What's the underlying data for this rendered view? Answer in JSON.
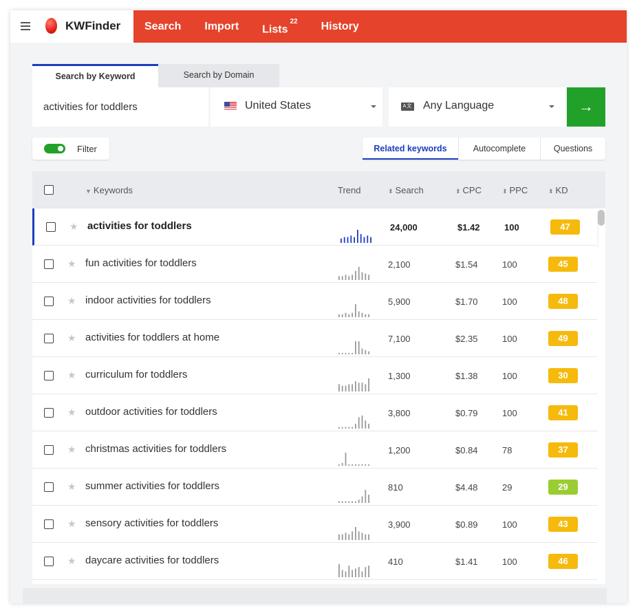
{
  "app": {
    "name": "KWFinder",
    "nav": [
      {
        "label": "Search",
        "badge": ""
      },
      {
        "label": "Import",
        "badge": ""
      },
      {
        "label": "Lists",
        "badge": "22"
      },
      {
        "label": "History",
        "badge": ""
      }
    ]
  },
  "search": {
    "tabs": [
      "Search by Keyword",
      "Search by Domain"
    ],
    "active_tab": "Search by Keyword",
    "keyword_value": "activities for toddlers",
    "location": "United States",
    "language": "Any Language",
    "lang_icon": "translate-icon",
    "go_icon": "→"
  },
  "filter": {
    "label": "Filter",
    "enabled": true
  },
  "keyword_tabs": [
    "Related keywords",
    "Autocomplete",
    "Questions"
  ],
  "active_keyword_tab": "Related keywords",
  "table": {
    "headers": {
      "keywords": "Keywords",
      "trend": "Trend",
      "search": "Search",
      "cpc": "CPC",
      "ppc": "PPC",
      "kd": "KD"
    },
    "rows": [
      {
        "keyword": "activities for toddlers",
        "search": "24,000",
        "cpc": "$1.42",
        "ppc": "100",
        "kd": "47",
        "kd_color": "#f6ba0d",
        "trend": [
          3,
          4,
          4,
          5,
          4,
          9,
          6,
          4,
          5,
          4
        ],
        "trend_color": "#1b3dbd"
      },
      {
        "keyword": "fun activities for toddlers",
        "search": "2,100",
        "cpc": "$1.54",
        "ppc": "100",
        "kd": "45",
        "kd_color": "#f6ba0d",
        "trend": [
          3,
          3,
          4,
          3,
          4,
          7,
          10,
          6,
          5,
          4
        ],
        "trend_color": "#999999"
      },
      {
        "keyword": "indoor activities for toddlers",
        "search": "5,900",
        "cpc": "$1.70",
        "ppc": "100",
        "kd": "48",
        "kd_color": "#f6ba0d",
        "trend": [
          2,
          2,
          3,
          2,
          3,
          9,
          4,
          3,
          2,
          2
        ],
        "trend_color": "#999999"
      },
      {
        "keyword": "activities for toddlers at home",
        "search": "7,100",
        "cpc": "$2.35",
        "ppc": "100",
        "kd": "49",
        "kd_color": "#f6ba0d",
        "trend": [
          1,
          1,
          1,
          1,
          1,
          9,
          9,
          4,
          3,
          2
        ],
        "trend_color": "#999999"
      },
      {
        "keyword": "curriculum for toddlers",
        "search": "1,300",
        "cpc": "$1.38",
        "ppc": "100",
        "kd": "30",
        "kd_color": "#f6ba0d",
        "trend": [
          5,
          4,
          4,
          5,
          5,
          7,
          6,
          6,
          5,
          9
        ],
        "trend_color": "#999999"
      },
      {
        "keyword": "outdoor activities for toddlers",
        "search": "3,800",
        "cpc": "$0.79",
        "ppc": "100",
        "kd": "41",
        "kd_color": "#f6ba0d",
        "trend": [
          1,
          1,
          1,
          1,
          1,
          3,
          7,
          8,
          5,
          3
        ],
        "trend_color": "#999999"
      },
      {
        "keyword": "christmas activities for toddlers",
        "search": "1,200",
        "cpc": "$0.84",
        "ppc": "78",
        "kd": "37",
        "kd_color": "#f6ba0d",
        "trend": [
          1,
          2,
          9,
          1,
          1,
          1,
          1,
          1,
          1,
          1
        ],
        "trend_color": "#999999"
      },
      {
        "keyword": "summer activities for toddlers",
        "search": "810",
        "cpc": "$4.48",
        "ppc": "29",
        "kd": "29",
        "kd_color": "#9acd32",
        "trend": [
          1,
          1,
          1,
          1,
          1,
          1,
          2,
          4,
          8,
          5
        ],
        "trend_color": "#999999"
      },
      {
        "keyword": "sensory activities for toddlers",
        "search": "3,900",
        "cpc": "$0.89",
        "ppc": "100",
        "kd": "43",
        "kd_color": "#f6ba0d",
        "trend": [
          4,
          4,
          5,
          4,
          6,
          9,
          6,
          5,
          4,
          4
        ],
        "trend_color": "#999999"
      },
      {
        "keyword": "daycare activities for toddlers",
        "search": "410",
        "cpc": "$1.41",
        "ppc": "100",
        "kd": "46",
        "kd_color": "#f6ba0d",
        "trend": [
          9,
          5,
          4,
          8,
          5,
          6,
          7,
          4,
          7,
          8
        ],
        "trend_color": "#999999"
      }
    ]
  },
  "colors": {
    "brand_red": "#e5432b",
    "accent_blue": "#1b3dbd",
    "go_green": "#22a12a",
    "kd_yellow": "#f6ba0d",
    "kd_green": "#9acd32"
  }
}
